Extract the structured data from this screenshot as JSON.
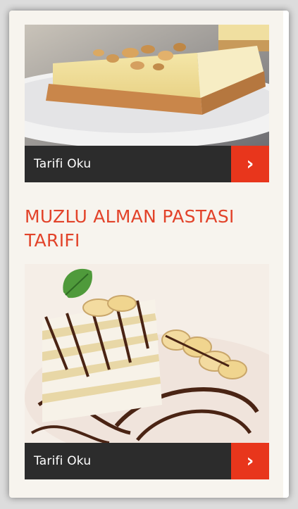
{
  "cards": [
    {
      "image": "cheesecake-image",
      "read_label": "Tarifi Oku",
      "arrow_icon": "chevron-right-icon",
      "arrow_glyph": "›"
    },
    {
      "image": "banana-cake-image",
      "read_label": "Tarifi Oku",
      "arrow_icon": "chevron-right-icon",
      "arrow_glyph": "›"
    }
  ],
  "recipe": {
    "title": "MUZLU ALMAN PASTASI TARIFI"
  },
  "colors": {
    "accent": "#e8361c",
    "title": "#e2432a",
    "bar": "#2c2c2c",
    "page_bg": "#f7f4ee"
  }
}
